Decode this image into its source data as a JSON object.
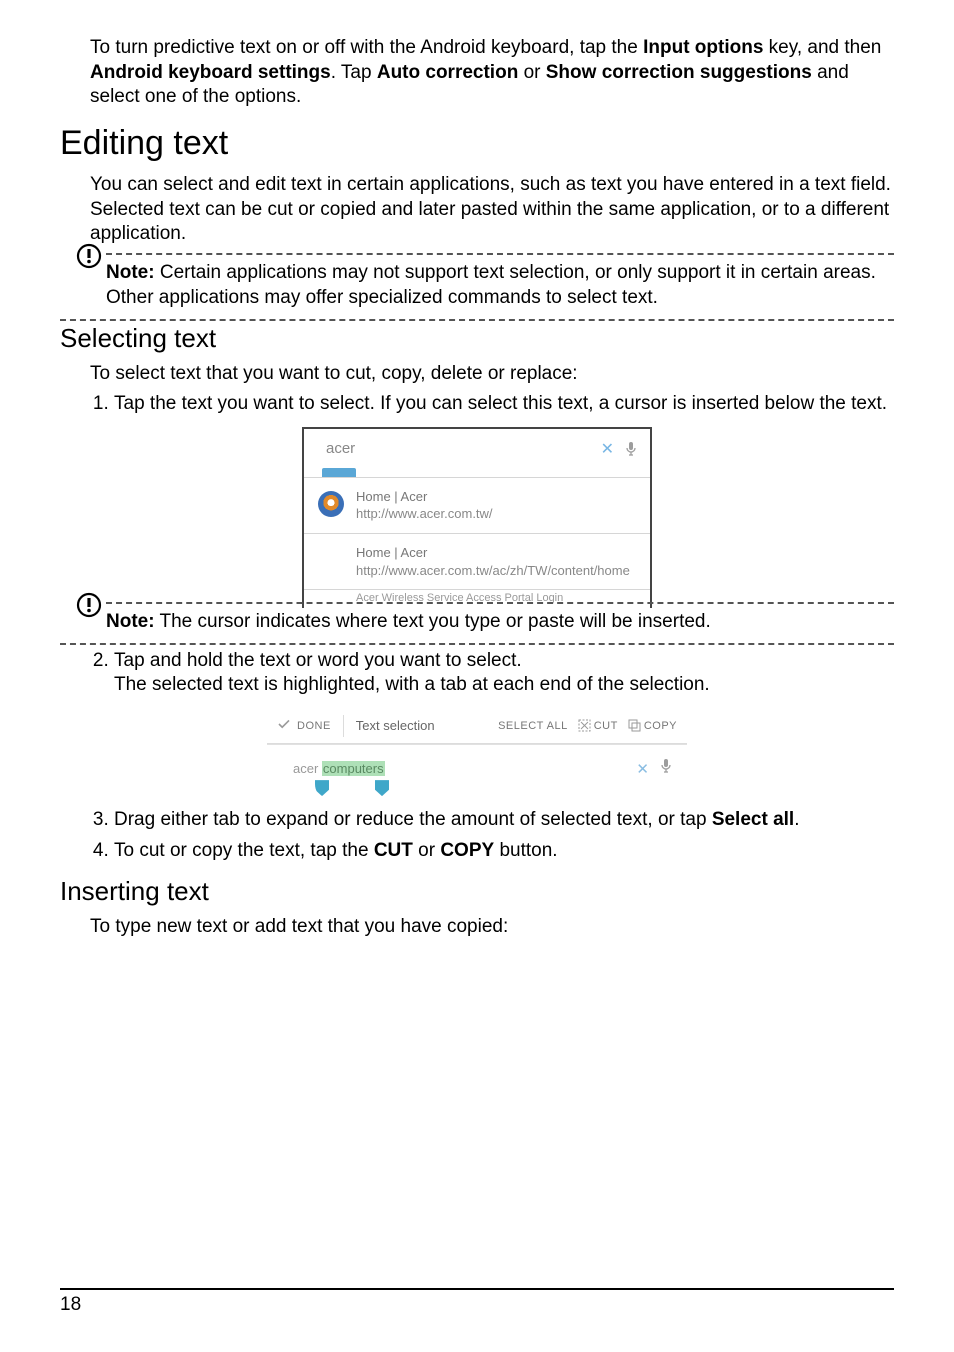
{
  "intro": {
    "pre": "To turn predictive text on or off with the Android keyboard, tap the ",
    "b1": "Input options",
    "mid1": " key, and then ",
    "b2": "Android keyboard settings",
    "mid2": ". Tap ",
    "b3": "Auto correction",
    "mid3": " or ",
    "b4": "Show correction suggestions",
    "post": " and select one of the options."
  },
  "h_editing": "Editing text",
  "editing_body": "You can select and edit text in certain applications, such as text you have entered in a text field. Selected text can be cut or copied and later pasted within the same application, or to a different application.",
  "note1": {
    "label": "Note:",
    "body": " Certain applications may not support text selection, or only support it in certain areas. Other applications may offer specialized commands to select text."
  },
  "h_selecting": "Selecting text",
  "selecting_intro": "To select text that you want to cut, copy, delete or replace:",
  "step1": "Tap the text you want to select. If you can select this text, a cursor is inserted below the text.",
  "fig1": {
    "term": "acer",
    "s1_title": "Home | Acer",
    "s1_url": "http://www.acer.com.tw/",
    "s2_title": "Home | Acer",
    "s2_url": "http://www.acer.com.tw/ac/zh/TW/content/home",
    "s3_partial": "Acer Wireless Service Access Portal Login"
  },
  "note2": {
    "label": "Note:",
    "body": " The cursor indicates where text you type or paste will be inserted."
  },
  "step2a": "Tap and hold the text or word you want to select.",
  "step2b": "The selected text is highlighted, with a tab at each end of the selection.",
  "fig2": {
    "done": "DONE",
    "title": "Text selection",
    "select_all": "SELECT ALL",
    "cut": "CUT",
    "copy": "COPY",
    "plain": "acer ",
    "highlight": "computers"
  },
  "step3": {
    "pre": "Drag either tab to expand or reduce the amount of selected text, or tap ",
    "b": "Select all",
    "post": "."
  },
  "step4": {
    "pre": "To cut or copy the text, tap the ",
    "b1": "CUT",
    "mid": " or ",
    "b2": "COPY",
    "post": " button."
  },
  "h_inserting": "Inserting text",
  "inserting_body": "To type new text or add text that you have copied:",
  "page_number": "18"
}
